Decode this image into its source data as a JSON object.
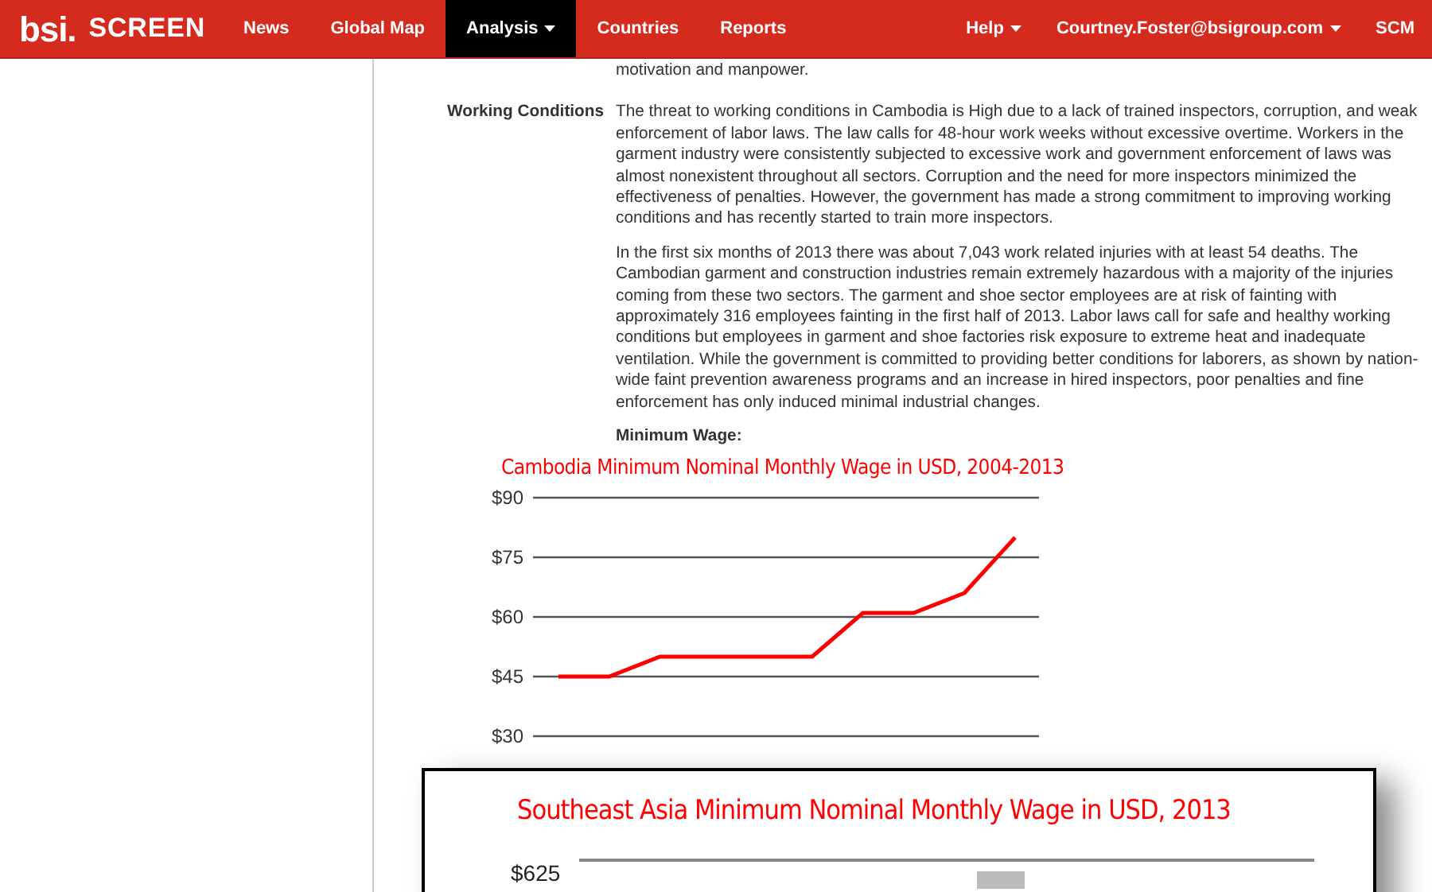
{
  "navbar": {
    "logo": {
      "brand": "bsi.",
      "product": "SCREEN"
    },
    "items": [
      {
        "label": "News",
        "selected": false,
        "dropdown": false
      },
      {
        "label": "Global Map",
        "selected": false,
        "dropdown": false
      },
      {
        "label": "Analysis",
        "selected": true,
        "dropdown": true
      },
      {
        "label": "Countries",
        "selected": false,
        "dropdown": false
      },
      {
        "label": "Reports",
        "selected": false,
        "dropdown": false
      }
    ],
    "right_items": [
      {
        "label": "Help",
        "dropdown": true
      },
      {
        "label": "Courtney.Foster@bsigroup.com",
        "dropdown": true
      },
      {
        "label": "SCM",
        "dropdown": false
      }
    ]
  },
  "content": {
    "previous_text": "motivation and manpower.",
    "section": {
      "label": "Working Conditions",
      "paragraphs": [
        "The threat to working conditions in Cambodia is High due to a lack of trained inspectors, corruption, and weak enforcement of labor laws. The law calls for 48-hour work weeks without excessive overtime. Workers in the garment industry were consistently subjected to excessive work and government enforcement of laws was almost nonexistent throughout all sectors. Corruption and the need for more inspectors minimized the effectiveness of penalties. However, the government has made a strong commitment to improving working conditions and has recently started to train more inspectors.",
        "In the first six months of 2013 there was about 7,043 work related injuries with at least 54 deaths. The Cambodian garment and construction industries remain extremely hazardous with a majority of the injuries coming from these two sectors. The garment and shoe sector employees are at risk of fainting with approximately 316 employees fainting in the first half of 2013. Labor laws call for safe and healthy working conditions but employees in garment and shoe factories risk exposure to extreme heat and inadequate ventilation. While the government is committed to providing better conditions for laborers, as shown by nation-wide faint prevention awareness programs and an increase in hired inspectors, poor penalties and fine enforcement has only induced minimal industrial changes."
      ],
      "subheading": "Minimum Wage:"
    },
    "chart_data": {
      "type": "line",
      "title": "Cambodia Minimum Nominal Monthly Wage in USD, 2004-2013",
      "series": [
        {
          "color": "#ff0000",
          "values": [
            45,
            45,
            50,
            50,
            50,
            50,
            61,
            61,
            66,
            80
          ]
        }
      ],
      "ylim": [
        30,
        90
      ],
      "grid": true,
      "yticks": [
        {
          "value": 90,
          "label": "$90"
        },
        {
          "value": 75,
          "label": "$75"
        },
        {
          "value": 60,
          "label": "$60"
        },
        {
          "value": 45,
          "label": "$45"
        },
        {
          "value": 30,
          "label": "$30"
        }
      ]
    }
  },
  "overlay_chart": {
    "title": "Southeast Asia Minimum Nominal Monthly Wage in USD, 2013",
    "tick_label": "$625"
  }
}
